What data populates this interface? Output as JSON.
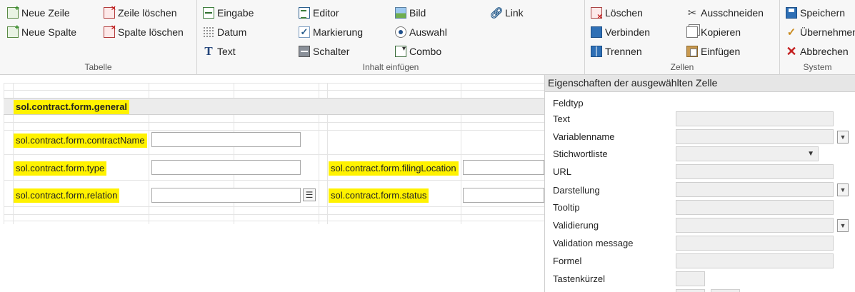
{
  "ribbon": {
    "tabelle": {
      "label": "Tabelle",
      "neue_zeile": "Neue Zeile",
      "neue_spalte": "Neue Spalte",
      "zeile_loeschen": "Zeile löschen",
      "spalte_loeschen": "Spalte löschen"
    },
    "inhalt": {
      "label": "Inhalt einfügen",
      "eingabe": "Eingabe",
      "datum": "Datum",
      "text": "Text",
      "editor": "Editor",
      "markierung": "Markierung",
      "schalter": "Schalter",
      "bild": "Bild",
      "auswahl": "Auswahl",
      "combo": "Combo",
      "link": "Link"
    },
    "zellen": {
      "label": "Zellen",
      "loeschen": "Löschen",
      "verbinden": "Verbinden",
      "trennen": "Trennen",
      "ausschneiden": "Ausschneiden",
      "kopieren": "Kopieren",
      "einfuegen": "Einfügen"
    },
    "system": {
      "label": "System",
      "speichern": "Speichern",
      "uebernehmen": "Übernehmen",
      "abbrechen": "Abbrechen"
    }
  },
  "form": {
    "section_title": "sol.contract.form.general",
    "fields": {
      "contract_name": "sol.contract.form.contractName",
      "type": "sol.contract.form.type",
      "filing_location": "sol.contract.form.filingLocation",
      "relation": "sol.contract.form.relation",
      "status": "sol.contract.form.status"
    }
  },
  "properties": {
    "title": "Eigenschaften der ausgewählten Zelle",
    "feldtyp": "Feldtyp",
    "text": "Text",
    "variablenname": "Variablenname",
    "stichwortliste": "Stichwortliste",
    "url": "URL",
    "darstellung": "Darstellung",
    "tooltip": "Tooltip",
    "validierung": "Validierung",
    "validation_message": "Validation message",
    "formel": "Formel",
    "tastenkuerzel": "Tastenkürzel"
  }
}
